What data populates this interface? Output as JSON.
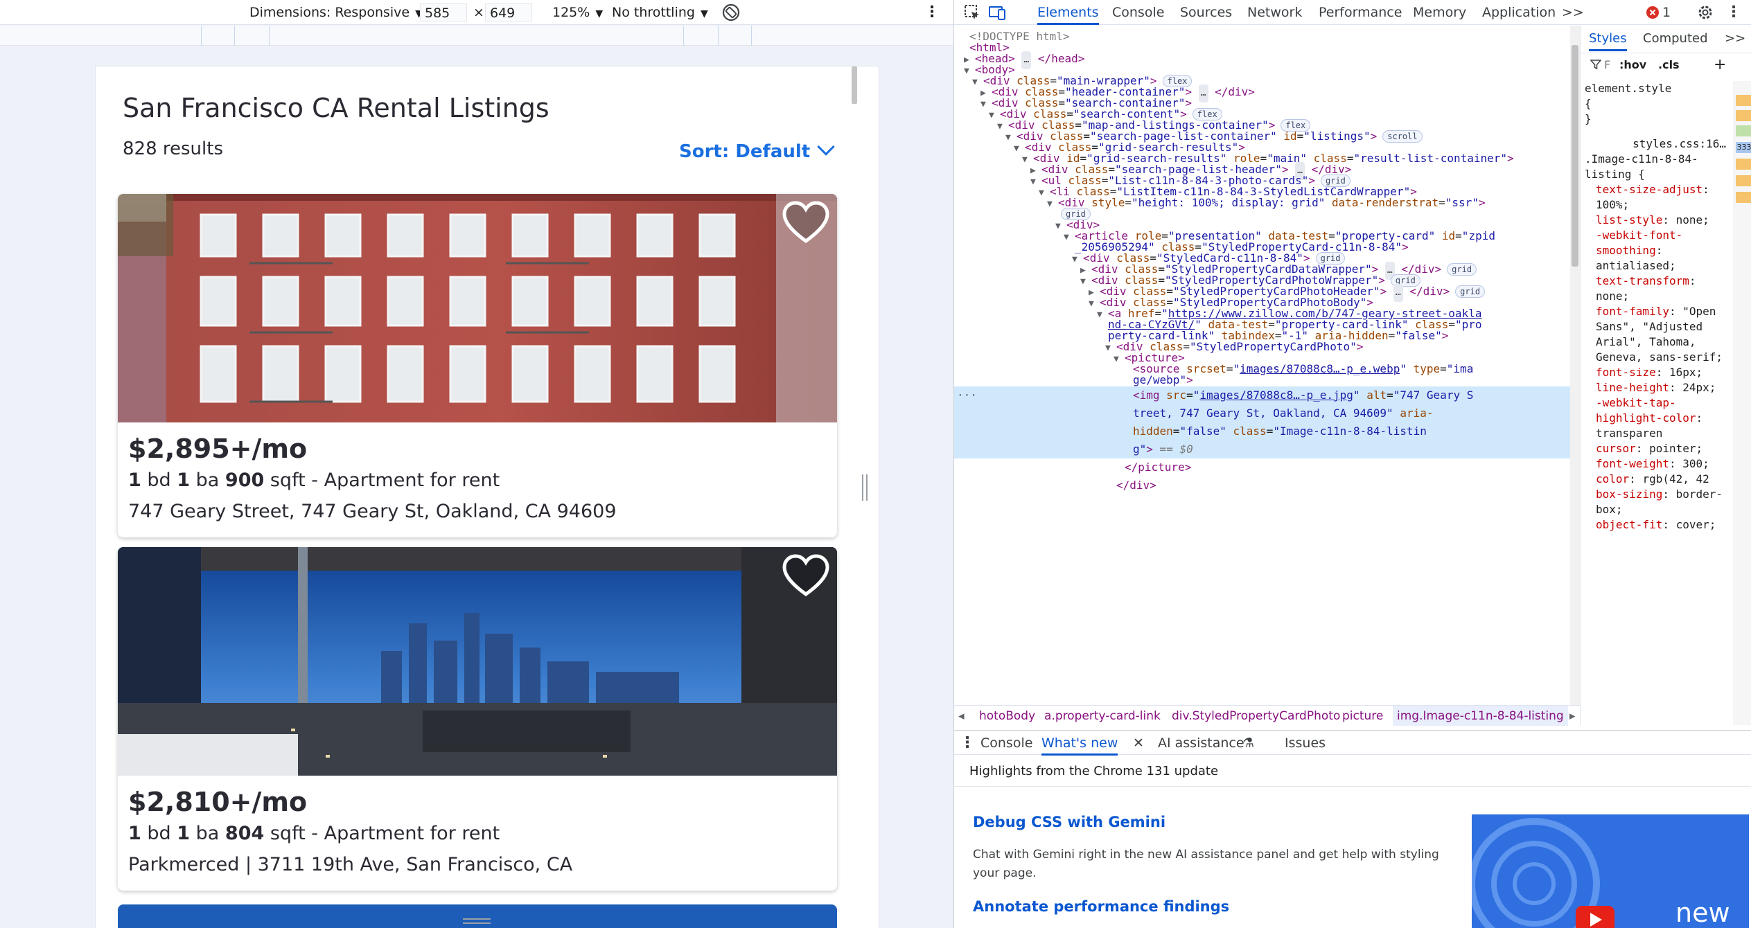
{
  "device_toolbar": {
    "dimensions_label": "Dimensions: Responsive",
    "width": "585",
    "times": "×",
    "height": "649",
    "zoom": "125%",
    "throttling": "No throttling",
    "rotate_icon": "rotate-icon",
    "more_icon": "more-vert-icon"
  },
  "page": {
    "title": "San Francisco CA Rental Listings",
    "result_count": "828 results",
    "sort_label": "Sort: Default",
    "accent_color": "#1a6fe0",
    "listings": [
      {
        "price": "$2,895+/mo",
        "beds": "1",
        "beds_unit": " bd ",
        "baths": "1",
        "baths_unit": " ba ",
        "sqft": "900",
        "sqft_unit": " sqft - Apartment for rent",
        "address": "747 Geary Street, 747 Geary St, Oakland, CA 94609"
      },
      {
        "price": "$2,810+/mo",
        "beds": "1",
        "beds_unit": " bd ",
        "baths": "1",
        "baths_unit": " ba ",
        "sqft": "804",
        "sqft_unit": " sqft - Apartment for rent",
        "address": "Parkmerced | 3711 19th Ave, San Francisco, CA"
      }
    ]
  },
  "devtools": {
    "tabs": [
      "Elements",
      "Console",
      "Sources",
      "Network",
      "Performance",
      "Memory",
      "Application"
    ],
    "more_tabs": ">>",
    "error_count": "1",
    "dom_lines": {
      "doctype": "<!DOCTYPE html>",
      "html": "html",
      "head": "head",
      "body": "body",
      "main_wrapper_class": "main-wrapper",
      "header_container_class": "header-container",
      "search_container_class": "search-container",
      "search_content_class": "search-content",
      "map_listings_class": "map-and-listings-container",
      "list_container_class": "search-page-list-container",
      "list_container_id": "listings",
      "grid_results_class": "grid-search-results",
      "grid_results_id": "grid-search-results",
      "grid_results_role": "main",
      "result_list_class": "result-list-container",
      "list_header_class": "search-page-list-header",
      "photo_cards_class": "List-c11n-8-84-3-photo-cards",
      "list_item_class": "ListItem-c11n-8-84-3-StyledListCardWrapper",
      "div_style": "height: 100%; display: grid",
      "renderstrat": "ssr",
      "article_role": "presentation",
      "article_test": "property-card",
      "article_id_1": "zpid",
      "article_id_2": "_2056905294",
      "article_class": "StyledPropertyCard-c11n-8-84",
      "styled_card_class": "StyledCard-c11n-8-84",
      "data_wrapper_class": "StyledPropertyCardDataWrapper",
      "photo_wrapper_class": "StyledPropertyCardPhotoWrapper",
      "photo_header_class": "StyledPropertyCardPhotoHeader",
      "photo_body_class": "StyledPropertyCardPhotoBody",
      "href_1": "https://www.zillow.com/b/747-geary-street-oakla",
      "href_2": "nd-ca-CYzGVt/",
      "link_test": "property-card-link",
      "link_class_1": "pro",
      "link_class_2": "perty-card-link",
      "tabindex": "-1",
      "aria_hidden": "false",
      "styled_photo_class": "StyledPropertyCardPhoto",
      "picture": "picture",
      "source_srcset": "images/87088c8…-p_e.webp",
      "source_type_1": "ima",
      "source_type_2": "ge/webp",
      "img_src": "images/87088c8…-p_e.jpg",
      "img_alt_1": "747 Geary S",
      "img_alt_2": "treet, 747 Geary St, Oakland, CA 94609",
      "img_class_1": "Image-c11n-8-84-listin",
      "img_class_2": "g",
      "dollar0": " == $0",
      "flex": "flex",
      "grid": "grid",
      "scroll": "scroll",
      "ellipsis": "…"
    },
    "breadcrumbs": [
      "hotoBody",
      "a.property-card-link",
      "div.StyledPropertyCardPhoto",
      "picture",
      "img.Image-c11n-8-84-listing"
    ],
    "styles_tabs": [
      "Styles",
      "Computed"
    ],
    "styles_more": ">>",
    "filter_hov": ":hov",
    "filter_cls": ".cls",
    "filter_placeholder": "F",
    "element_style": "element.style",
    "element_style_open": "{",
    "element_style_close": "}",
    "rule_source": "styles.css:16…",
    "rule_selector": ".Image-c11n-8-84-listing {",
    "declarations": [
      {
        "prop": "text-size-adjust",
        "val": "100%;"
      },
      {
        "prop": "list-style",
        "val": "none;"
      },
      {
        "prop": "-webkit-font-smoothing",
        "val": "antialiased;"
      },
      {
        "prop": "text-transform",
        "val": "none;"
      },
      {
        "prop": "font-family",
        "val": "\"Open Sans\", \"Adjusted Arial\", Tahoma, Geneva, sans-serif;"
      },
      {
        "prop": "font-size",
        "val": "16px;"
      },
      {
        "prop": "line-height",
        "val": "24px;"
      },
      {
        "prop": "-webkit-tap-highlight-color",
        "val": "transparen"
      },
      {
        "prop": "cursor",
        "val": "pointer;"
      },
      {
        "prop": "font-weight",
        "val": "300;"
      },
      {
        "prop": "color",
        "val": "rgb(42, 42"
      },
      {
        "prop": "box-sizing",
        "val": "border-box;"
      },
      {
        "prop": "object-fit",
        "val": "cover;"
      }
    ],
    "side_value": "333"
  },
  "drawer": {
    "tabs": [
      "Console",
      "What's new",
      "AI assistance",
      "Issues"
    ],
    "header": "Highlights from the Chrome 131 update",
    "item1_title": "Debug CSS with Gemini",
    "item1_desc": "Chat with Gemini right in the new AI assistance panel and get help with styling your page.",
    "item2_title": "Annotate performance findings",
    "banner_text": "new"
  }
}
